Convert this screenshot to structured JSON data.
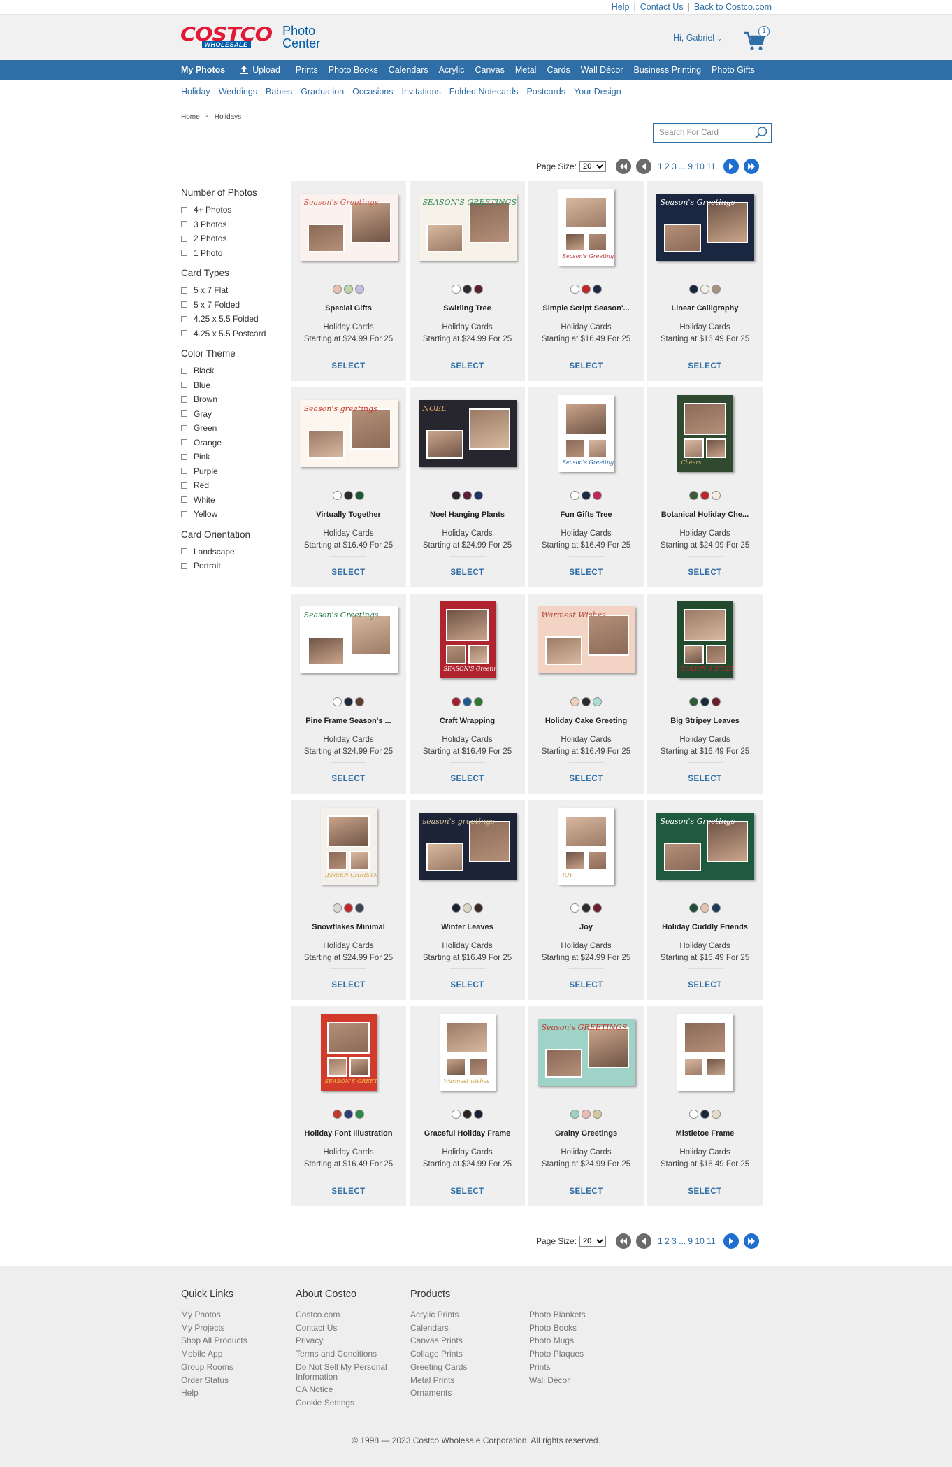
{
  "util_links": [
    "Help",
    "Contact Us",
    "Back to Costco.com"
  ],
  "logo": {
    "brand": "COSTCO",
    "sub": "WHOLESALE",
    "product_line1": "Photo",
    "product_line2": "Center"
  },
  "header": {
    "greeting": "Hi, Gabriel",
    "cart_count": "1"
  },
  "main_nav": {
    "my_photos": "My Photos",
    "upload": "Upload",
    "items": [
      "Prints",
      "Photo Books",
      "Calendars",
      "Acrylic",
      "Canvas",
      "Metal",
      "Cards",
      "Wall Décor",
      "Business Printing",
      "Photo Gifts"
    ]
  },
  "sub_nav": [
    "Holiday",
    "Weddings",
    "Babies",
    "Graduation",
    "Occasions",
    "Invitations",
    "Folded Notecards",
    "Postcards",
    "Your Design"
  ],
  "breadcrumb": [
    "Home",
    "Holidays"
  ],
  "search": {
    "placeholder": "Search For Card"
  },
  "pager": {
    "label": "Page Size:",
    "size": "20",
    "pages": "1 2 3 ... 9 10 11"
  },
  "filters": [
    {
      "title": "Number of Photos",
      "options": [
        "4+ Photos",
        "3 Photos",
        "2 Photos",
        "1 Photo"
      ]
    },
    {
      "title": "Card Types",
      "options": [
        "5 x 7 Flat",
        "5 x 7 Folded",
        "4.25 x 5.5 Folded",
        "4.25 x 5.5 Postcard"
      ]
    },
    {
      "title": "Color Theme",
      "options": [
        "Black",
        "Blue",
        "Brown",
        "Gray",
        "Green",
        "Orange",
        "Pink",
        "Purple",
        "Red",
        "White",
        "Yellow"
      ]
    },
    {
      "title": "Card Orientation",
      "options": [
        "Landscape",
        "Portrait"
      ]
    }
  ],
  "card_common": {
    "category": "Holiday Cards",
    "select": "SELECT"
  },
  "cards": [
    {
      "name": "Special Gifts",
      "price": "Starting at $24.99 For 25",
      "colors": [
        "#e8bfb3",
        "#bcd5a9",
        "#c3bfe3"
      ],
      "orient": "land",
      "bg": "#fbf1ee",
      "accent": "#c8574a",
      "text": "Season's Greetings"
    },
    {
      "name": "Swirling Tree",
      "price": "Starting at $24.99 For 25",
      "colors": [
        "#ffffff",
        "#2b2b2b",
        "#5b1f2a"
      ],
      "orient": "land",
      "bg": "#f6f2ea",
      "accent": "#2f8a57",
      "text": "SEASON'S GREETINGS"
    },
    {
      "name": "Simple Script Season'...",
      "price": "Starting at $16.49 For 25",
      "colors": [
        "#ffffff",
        "#c0272d",
        "#1b2a44"
      ],
      "orient": "port",
      "bg": "#ffffff",
      "accent": "#b5343b",
      "text": "Season's Greetings"
    },
    {
      "name": "Linear Calligraphy",
      "price": "Starting at $16.49 For 25",
      "colors": [
        "#18243c",
        "#f4f0e8",
        "#a59280"
      ],
      "orient": "land",
      "bg": "#1b2640",
      "accent": "#ffffff",
      "text": "Season's Greetings"
    },
    {
      "name": "Virtually Together",
      "price": "Starting at $16.49 For 25",
      "colors": [
        "#ffffff",
        "#2b2b2b",
        "#1c5a3a"
      ],
      "orient": "land",
      "bg": "#fdf6ef",
      "accent": "#c0392b",
      "text": "Season's greetings"
    },
    {
      "name": "Noel Hanging Plants",
      "price": "Starting at $24.99 For 25",
      "colors": [
        "#2b2530",
        "#5c1e3b",
        "#1f3566"
      ],
      "orient": "land",
      "bg": "#27252e",
      "accent": "#d9a86a",
      "text": "NOEL"
    },
    {
      "name": "Fun Gifts Tree",
      "price": "Starting at $16.49 For 25",
      "colors": [
        "#ffffff",
        "#1b2a44",
        "#c0275a"
      ],
      "orient": "port",
      "bg": "#ffffff",
      "accent": "#2a68b0",
      "text": "Season's Greetings"
    },
    {
      "name": "Botanical Holiday Che...",
      "price": "Starting at $24.99 For 25",
      "colors": [
        "#3d5a38",
        "#c0272d",
        "#f3ece0"
      ],
      "orient": "port",
      "bg": "#2f4a30",
      "accent": "#d9b36a",
      "text": "Cheers"
    },
    {
      "name": "Pine Frame Season's ...",
      "price": "Starting at $24.99 For 25",
      "colors": [
        "#ffffff",
        "#1b2a3a",
        "#5b4030"
      ],
      "orient": "land",
      "bg": "#ffffff",
      "accent": "#2e7d4f",
      "text": "Season's Greetings"
    },
    {
      "name": "Craft Wrapping",
      "price": "Starting at $16.49 For 25",
      "colors": [
        "#a31f2a",
        "#1d5a8c",
        "#2f7a2e"
      ],
      "orient": "port",
      "bg": "#b0242f",
      "accent": "#ffffff",
      "text": "SEASON'S Greetings"
    },
    {
      "name": "Holiday Cake Greeting",
      "price": "Starting at $16.49 For 25",
      "colors": [
        "#f0cdbd",
        "#2b2b2b",
        "#a8ddd2"
      ],
      "orient": "land",
      "bg": "#f2d3c4",
      "accent": "#b04a3c",
      "text": "Warmest Wishes"
    },
    {
      "name": "Big Stripey Leaves",
      "price": "Starting at $16.49 For 25",
      "colors": [
        "#2f5a38",
        "#1b2a3a",
        "#6b1f2a"
      ],
      "orient": "port",
      "bg": "#214a2e",
      "accent": "#c0272d",
      "text": "SEASON'S GREETINGS"
    },
    {
      "name": "Snowflakes Minimal",
      "price": "Starting at $24.99 For 25",
      "colors": [
        "#d8d8d8",
        "#c0272d",
        "#3a4656"
      ],
      "orient": "port",
      "bg": "#f4f1ec",
      "accent": "#d2a24a",
      "text": "JENSEN CHRISTMAS"
    },
    {
      "name": "Winter Leaves",
      "price": "Starting at $16.49 For 25",
      "colors": [
        "#1b2030",
        "#dcd6c6",
        "#3a2a22"
      ],
      "orient": "land",
      "bg": "#1d2438",
      "accent": "#d6c7a0",
      "text": "season's greetings"
    },
    {
      "name": "Joy",
      "price": "Starting at $24.99 For 25",
      "colors": [
        "#ffffff",
        "#2b2b2b",
        "#6b1f2a"
      ],
      "orient": "port",
      "bg": "#ffffff",
      "accent": "#caa24e",
      "text": "JOY"
    },
    {
      "name": "Holiday Cuddly Friends",
      "price": "Starting at $16.49 For 25",
      "colors": [
        "#1f4d3a",
        "#e8c2b0",
        "#1b3a5a"
      ],
      "orient": "land",
      "bg": "#1f5a3e",
      "accent": "#ffffff",
      "text": "Season's Greetings"
    },
    {
      "name": "Holiday Font Illustration",
      "price": "Starting at $16.49 For 25",
      "colors": [
        "#c0392b",
        "#2c3e7a",
        "#2f8a4a"
      ],
      "orient": "port",
      "bg": "#d23a2b",
      "accent": "#f2c14e",
      "text": "SEASON'S GREETINGS"
    },
    {
      "name": "Graceful Holiday Frame",
      "price": "Starting at $24.99 For 25",
      "colors": [
        "#ffffff",
        "#2b2022",
        "#1b2235"
      ],
      "orient": "port",
      "bg": "#ffffff",
      "accent": "#c9a04a",
      "text": "Warmest wishes"
    },
    {
      "name": "Grainy Greetings",
      "price": "Starting at $24.99 For 25",
      "colors": [
        "#9fd0c6",
        "#e8bcb0",
        "#d6c8a0"
      ],
      "orient": "land",
      "bg": "#9fd3c8",
      "accent": "#c0392b",
      "text": "Season's GREETINGS"
    },
    {
      "name": "Mistletoe Frame",
      "price": "Starting at $16.49 For 25",
      "colors": [
        "#ffffff",
        "#1b2a3a",
        "#e6dccb"
      ],
      "orient": "port",
      "bg": "#ffffff",
      "accent": "#3d8a4a",
      "text": ""
    }
  ],
  "footer": {
    "quick_links": {
      "title": "Quick Links",
      "links": [
        "My Photos",
        "My Projects",
        "Shop All Products",
        "Mobile App",
        "Group Rooms",
        "Order Status",
        "Help"
      ]
    },
    "about": {
      "title": "About Costco",
      "links": [
        "Costco.com",
        "Contact Us",
        "Privacy",
        "Terms and Conditions",
        "Do Not Sell My Personal Information",
        "CA Notice",
        "Cookie Settings"
      ]
    },
    "products": {
      "title": "Products",
      "links": [
        "Acrylic Prints",
        "Calendars",
        "Canvas Prints",
        "Collage Prints",
        "Greeting Cards",
        "Metal Prints",
        "Ornaments"
      ]
    },
    "products2": {
      "links": [
        "Photo Blankets",
        "Photo Books",
        "Photo Mugs",
        "Photo Plaques",
        "Prints",
        "Wall Décor"
      ]
    },
    "copyright": "© 1998 — 2023 Costco Wholesale Corporation. All rights reserved."
  }
}
